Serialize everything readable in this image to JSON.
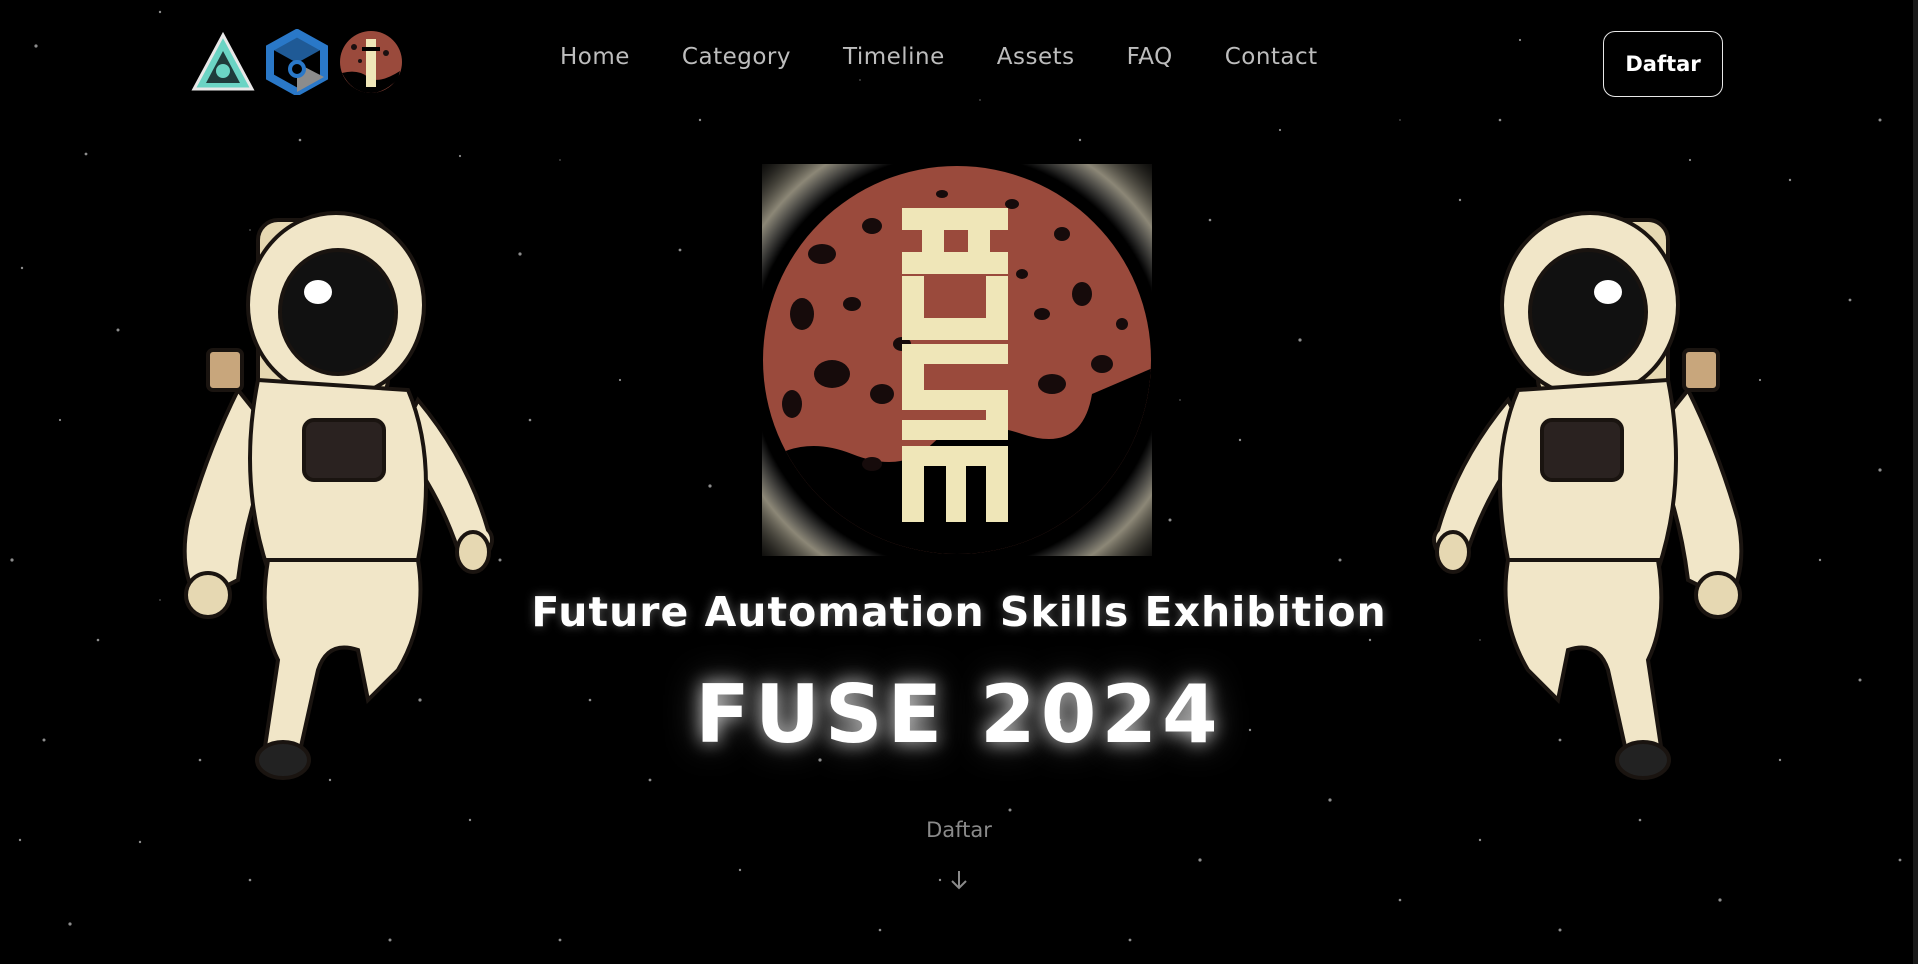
{
  "nav": {
    "logos": [
      "triangle-logo-icon",
      "hexagon-logo-icon",
      "fuse-planet-logo-icon"
    ],
    "items": [
      {
        "label": "Home"
      },
      {
        "label": "Category"
      },
      {
        "label": "Timeline"
      },
      {
        "label": "Assets"
      },
      {
        "label": "FAQ"
      },
      {
        "label": "Contact"
      }
    ],
    "cta_label": "Daftar"
  },
  "hero": {
    "subtitle": "Future Automation Skills Exhibition",
    "title": "FUSE 2024",
    "scroll_label": "Daftar",
    "planet_logo_text": "FUSE"
  },
  "colors": {
    "background": "#000000",
    "planet": "#9a4a3c",
    "logo_cream": "#efe6b8",
    "nav_text": "#bdbdbd",
    "suit": "#f1e6c8"
  }
}
